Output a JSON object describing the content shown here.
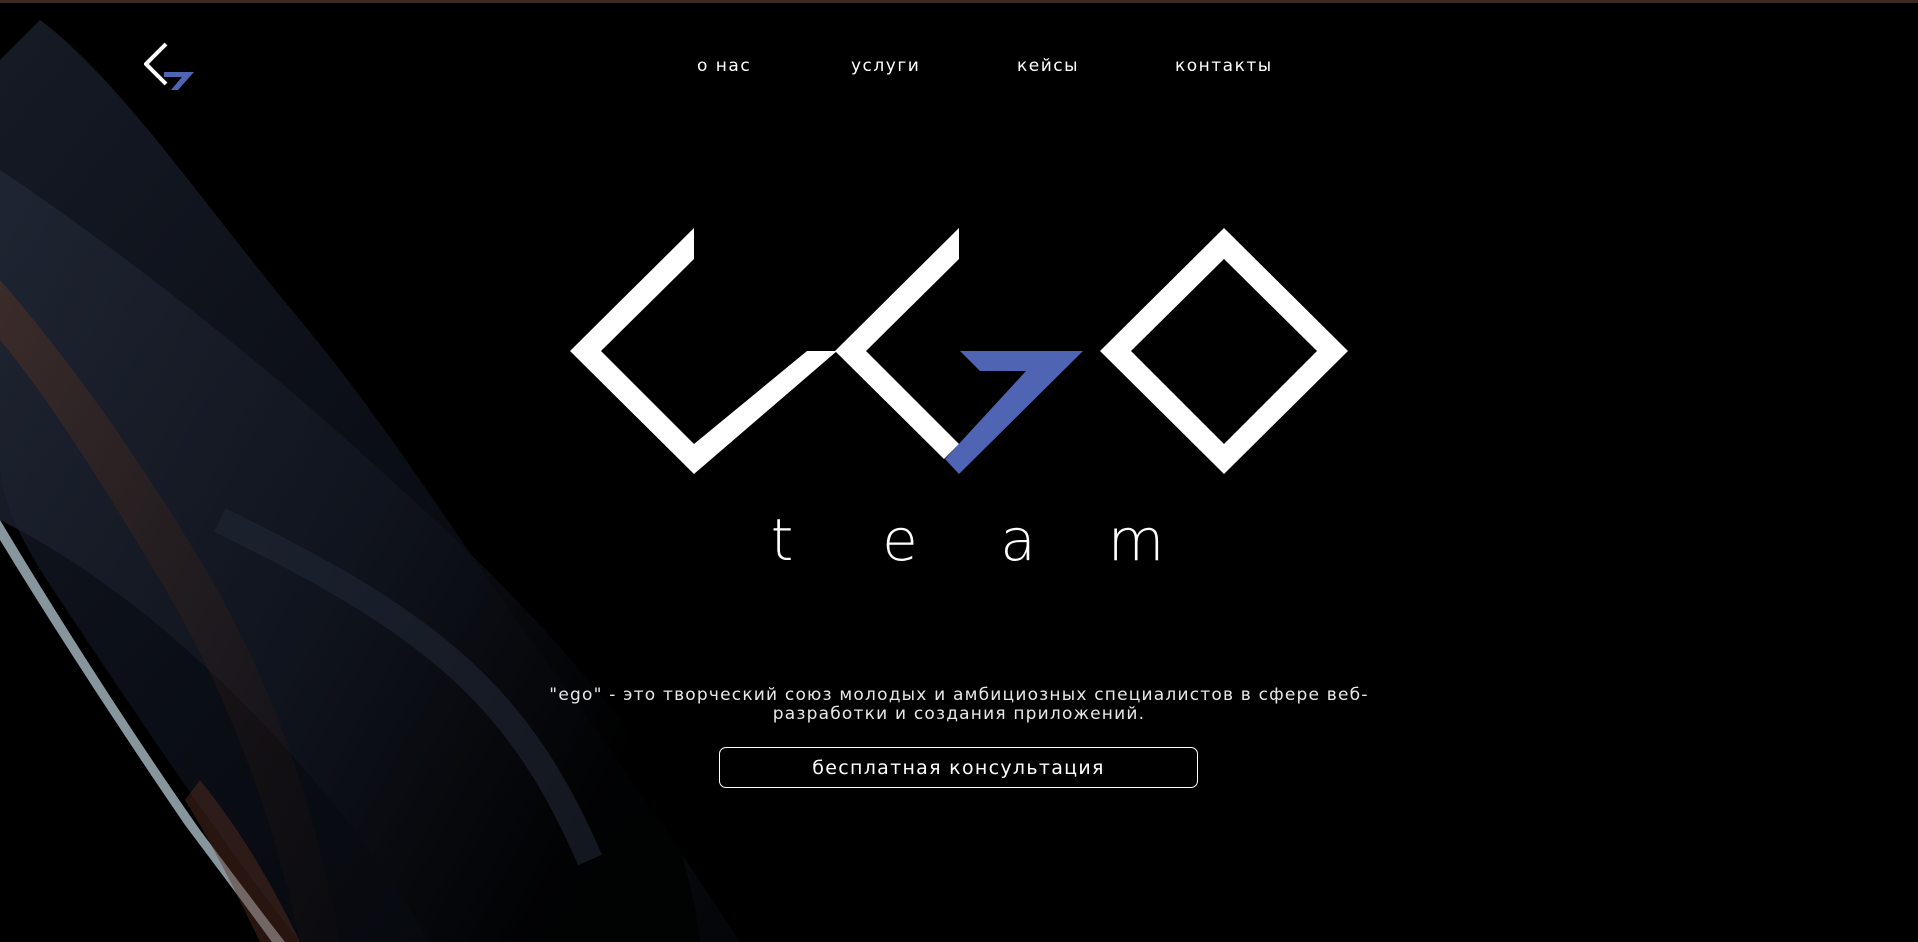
{
  "nav": {
    "items": [
      {
        "label": "о нас"
      },
      {
        "label": "услуги"
      },
      {
        "label": "кейсы"
      },
      {
        "label": "контакты"
      }
    ]
  },
  "logo": {
    "text": "ego",
    "accent_color": "#4f65b4"
  },
  "hero": {
    "team_letters": [
      "t",
      "e",
      "a",
      "m"
    ],
    "tagline": "\"ego\" - это творческий союз молодых и амбициозных специалистов в сфере веб-разработки и создания приложений.",
    "cta_label": "бесплатная консультация"
  },
  "colors": {
    "background": "#000000",
    "accent": "#4f65b4",
    "text": "#ffffff"
  }
}
